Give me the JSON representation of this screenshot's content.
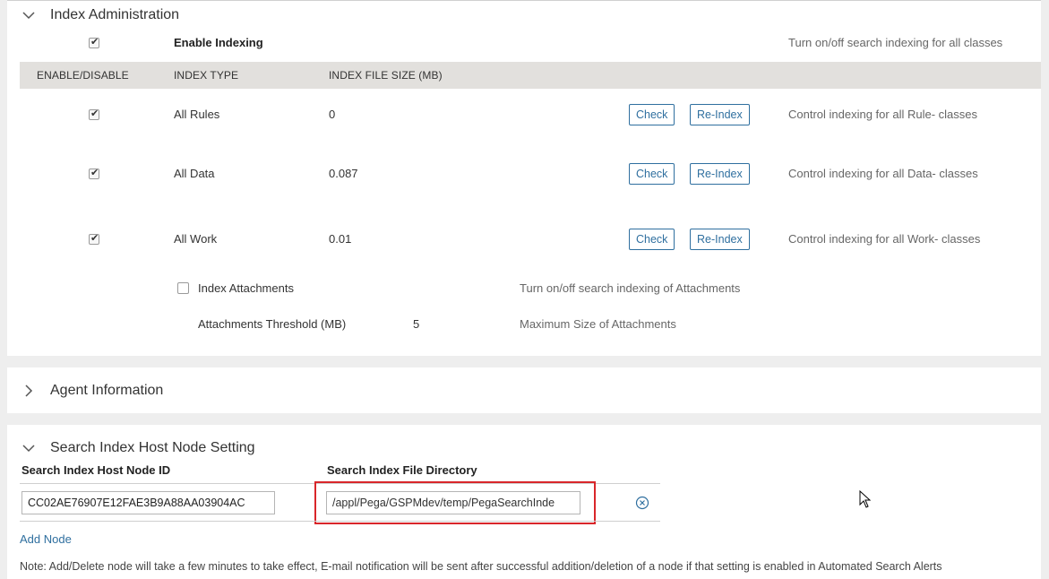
{
  "index_admin": {
    "title": "Index Administration",
    "enable_indexing": {
      "label": "Enable Indexing",
      "checked": true,
      "description": "Turn on/off search indexing for all classes"
    },
    "columns": [
      "ENABLE/DISABLE",
      "INDEX TYPE",
      "INDEX FILE SIZE (MB)"
    ],
    "rows": [
      {
        "checked": true,
        "type": "All Rules",
        "size": "0",
        "check_label": "Check",
        "reindex_label": "Re-Index",
        "description": "Control indexing for all Rule- classes"
      },
      {
        "checked": true,
        "type": "All Data",
        "size": "0.087",
        "check_label": "Check",
        "reindex_label": "Re-Index",
        "description": "Control indexing for all Data- classes"
      },
      {
        "checked": true,
        "type": "All Work",
        "size": "0.01",
        "check_label": "Check",
        "reindex_label": "Re-Index",
        "description": "Control indexing for all Work- classes"
      }
    ],
    "attachments": {
      "label": "Index Attachments",
      "checked": false,
      "description": "Turn on/off search indexing of Attachments",
      "threshold_label": "Attachments Threshold (MB)",
      "threshold_value": "5",
      "threshold_description": "Maximum Size of Attachments"
    }
  },
  "agent_info": {
    "title": "Agent Information"
  },
  "search_host": {
    "title": "Search Index Host Node Setting",
    "col_node_id": "Search Index Host Node ID",
    "col_directory": "Search Index File Directory",
    "node_id_value": "CC02AE76907E12FAE3B9A88AA03904AC",
    "directory_value": "/appl/Pega/GSPMdev/temp/PegaSearchInde",
    "add_node_label": "Add Node",
    "note": "Note: Add/Delete node will take a few minutes to take effect, E-mail notification will be sent after successful addition/deletion of a node if that setting is enabled in Automated Search Alerts"
  },
  "icons": {
    "collapse": "chevron-down-icon",
    "expand": "chevron-right-icon",
    "remove": "remove-circle-icon",
    "cursor": "mouse-pointer-icon"
  },
  "colors": {
    "accent": "#2f6f9f",
    "highlight": "#d9262a",
    "header_bg": "#e2e0dd"
  }
}
